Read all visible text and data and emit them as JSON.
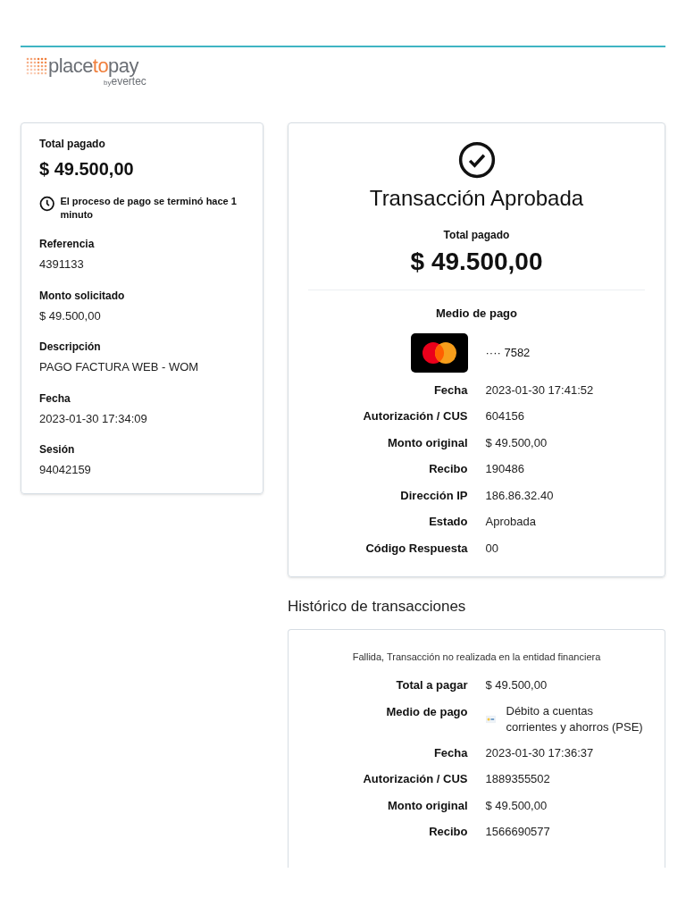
{
  "logo": {
    "parts": [
      {
        "text": "place",
        "accent": false
      },
      {
        "text": "to",
        "accent": true
      },
      {
        "text": "pay",
        "accent": false
      }
    ],
    "by": "by",
    "company": "evertec"
  },
  "summary": {
    "total_label": "Total pagado",
    "total": "$ 49.500,00",
    "notice": "El proceso de pago se terminó hace 1 minuto",
    "fields": [
      {
        "label": "Referencia",
        "value": "4391133"
      },
      {
        "label": "Monto solicitado",
        "value": "$ 49.500,00"
      },
      {
        "label": "Descripción",
        "value": "PAGO FACTURA WEB - WOM"
      },
      {
        "label": "Fecha",
        "value": "2023-01-30 17:34:09"
      },
      {
        "label": "Sesión",
        "value": "94042159"
      }
    ]
  },
  "result": {
    "kind": "approved",
    "title": "Transacción Aprobada",
    "total_label": "Total pagado",
    "total": "$ 49.500,00",
    "method_label": "Medio de pago",
    "card_number": "···· 7582",
    "rows": [
      {
        "label": "Fecha",
        "value": "2023-01-30 17:41:52"
      },
      {
        "label": "Autorización / CUS",
        "value": "604156"
      },
      {
        "label": "Monto original",
        "value": "$ 49.500,00"
      },
      {
        "label": "Recibo",
        "value": "190486"
      },
      {
        "label": "Dirección IP",
        "value": "186.86.32.40"
      },
      {
        "label": "Estado",
        "value": "Aprobada"
      },
      {
        "label": "Código Respuesta",
        "value": "00"
      }
    ]
  },
  "history": {
    "title": "Histórico de transacciones",
    "entries": [
      {
        "message": "Fallida, Transacción no realizada en la entidad financiera",
        "rows": [
          {
            "kind": "text",
            "label": "Total a pagar",
            "value": "$ 49.500,00"
          },
          {
            "kind": "method",
            "label": "Medio de pago",
            "value": "Débito a cuentas corrientes y ahorros (PSE)"
          },
          {
            "kind": "text",
            "label": "Fecha",
            "value": "2023-01-30 17:36:37"
          },
          {
            "kind": "text",
            "label": "Autorización / CUS",
            "value": "1889355502"
          },
          {
            "kind": "text",
            "label": "Monto original",
            "value": "$ 49.500,00"
          },
          {
            "kind": "text",
            "label": "Recibo",
            "value": "1566690577"
          }
        ]
      }
    ]
  }
}
